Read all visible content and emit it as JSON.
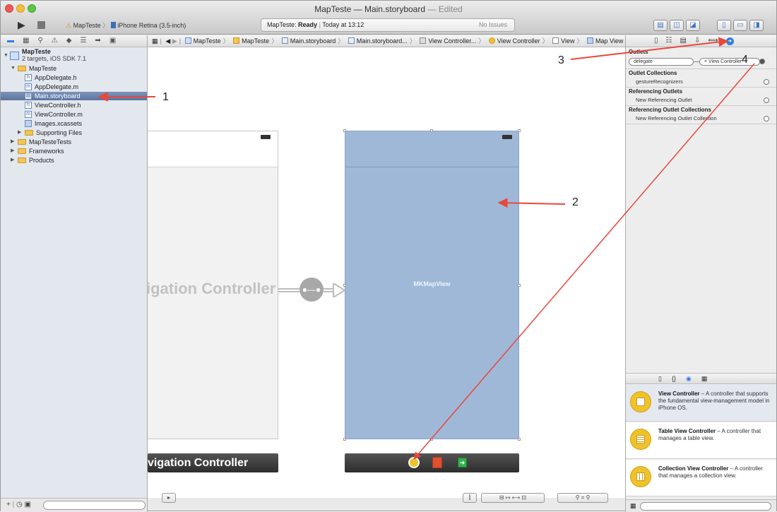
{
  "window": {
    "title": "MapTeste — ",
    "title_file": "Main.storyboard",
    "title_state": " — Edited"
  },
  "toolbar": {
    "run_label": "▶",
    "scheme": "MapTeste",
    "device": "iPhone Retina (3.5-inch)",
    "activity_app": "MapTeste:",
    "activity_status": "Ready",
    "activity_time": "Today at 13:12",
    "activity_issues": "No Issues"
  },
  "navigator": {
    "project": "MapTeste",
    "project_sub": "2 targets, iOS SDK 7.1",
    "group": "MapTeste",
    "files": [
      "AppDelegate.h",
      "AppDelegate.m",
      "Main.storyboard",
      "ViewController.h",
      "ViewController.m",
      "Images.xcassets"
    ],
    "file_badges": [
      "h",
      "m",
      "",
      "h",
      "m",
      ""
    ],
    "supporting": "Supporting Files",
    "groups": [
      "MapTesteTests",
      "Frameworks",
      "Products"
    ]
  },
  "breadcrumb": [
    "MapTeste",
    "MapTeste",
    "Main.storyboard",
    "Main.storyboard...",
    "View Controller...",
    "View Controller",
    "View",
    "Map View"
  ],
  "canvas": {
    "nav_controller_title": "igation Controller",
    "nav_controller_dock": "vigation Controller",
    "map_view_label": "MKMapView"
  },
  "inspector": {
    "outlets_header": "Outlets",
    "outlet_name": "delegate",
    "outlet_target": "View Controller",
    "outlet_collections_header": "Outlet Collections",
    "outlet_collection_item": "gestureRecognizers",
    "ref_outlets_header": "Referencing Outlets",
    "ref_outlets_item": "New Referencing Outlet",
    "ref_collections_header": "Referencing Outlet Collections",
    "ref_collections_item": "New Referencing Outlet Collection"
  },
  "library": [
    {
      "title": "View Controller",
      "desc": " – A controller that supports the fundamental view-management model in iPhone OS."
    },
    {
      "title": "Table View Controller",
      "desc": " – A controller that manages a table view."
    },
    {
      "title": "Collection View Controller",
      "desc": " – A controller that manages a collection view."
    }
  ],
  "annotations": [
    "1",
    "2",
    "3",
    "4"
  ],
  "colors": {
    "arrow": "#e8483b",
    "selection": "#5b74a0",
    "map_view": "#a0b8d8",
    "accent": "#2d7fe0"
  }
}
